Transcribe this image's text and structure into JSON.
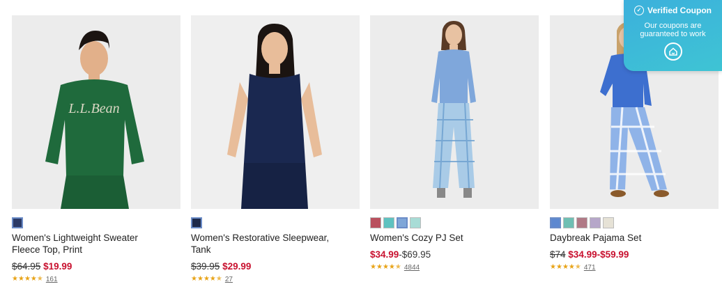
{
  "products": [
    {
      "name": "Women's Lightweight Sweater Fleece Top, Print",
      "was_price": "$64.95",
      "sale_price": "$19.99",
      "range_price": "",
      "rating_stars": 4.5,
      "review_count": "161",
      "swatches": [
        "#2b3a66"
      ],
      "selected_swatch": 0,
      "photo": {
        "bg": "#ececec",
        "top": "#1f6a3c",
        "bottom": "#1f6a3c",
        "skin": "#e2b08a",
        "hair": "#1b1411",
        "print": "#d9d7c3"
      }
    },
    {
      "name": "Women's Restorative Sleepwear, Tank",
      "was_price": "$39.95",
      "sale_price": "$29.99",
      "range_price": "",
      "rating_stars": 4.5,
      "review_count": "27",
      "swatches": [
        "#1e2a4a"
      ],
      "selected_swatch": 0,
      "photo": {
        "bg": "#efefef",
        "top": "#1a2850",
        "bottom": "#1a2850",
        "skin": "#e8bd9a",
        "hair": "#1b1411"
      }
    },
    {
      "name": "Women's Cozy PJ Set",
      "was_price": "",
      "sale_price": "$34.99",
      "range_price": "-$69.95",
      "rating_stars": 4.5,
      "review_count": "4844",
      "swatches": [
        "#b9505e",
        "#5fc2c0",
        "#7fa6d8",
        "#a8dcd6"
      ],
      "selected_swatch": 2,
      "photo": {
        "bg": "#ececec",
        "top": "#7fa7db",
        "bottom": "#a9cbe7",
        "skin": "#e8c2a2",
        "hair": "#5a3b26"
      }
    },
    {
      "name": "Daybreak Pajama Set",
      "was_price": "$74",
      "sale_price": "$34.99-$59.99",
      "range_price": "",
      "rating_stars": 4.5,
      "review_count": "471",
      "swatches": [
        "#5d88d0",
        "#6fbfb3",
        "#b07a86",
        "#b6a7c9",
        "#e6e2d6"
      ],
      "selected_swatch": 0,
      "photo": {
        "bg": "#ececec",
        "top": "#3d6fcf",
        "bottom": "#8fb3e8",
        "skin": "#e6c3a4",
        "hair": "#c9a26b"
      }
    }
  ],
  "coupon": {
    "title": "Verified Coupon",
    "line1": "Our coupons are",
    "line2": "guaranteed to work",
    "bg": "#3cb0dc"
  }
}
